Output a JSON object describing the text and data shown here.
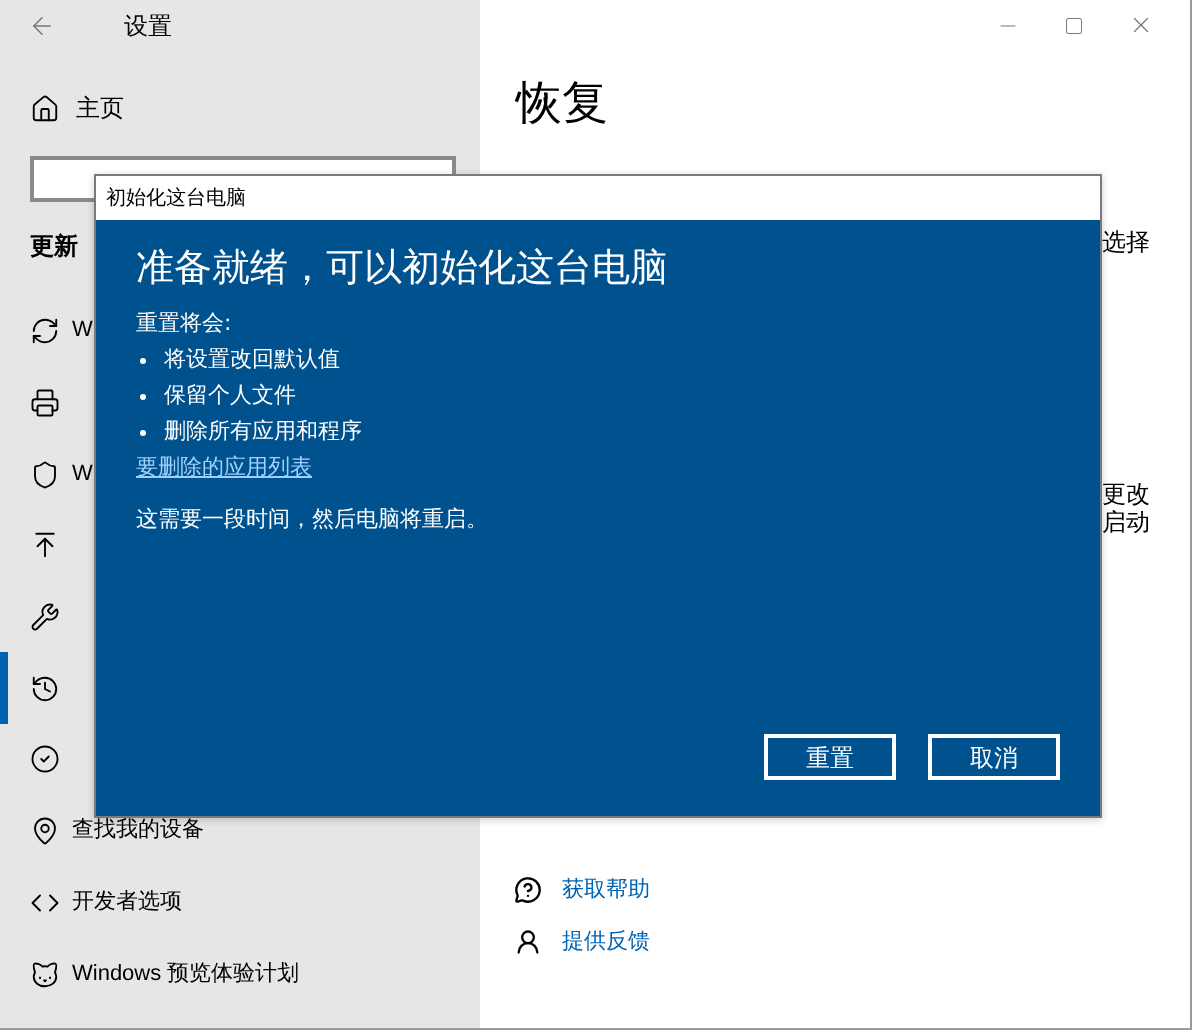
{
  "window": {
    "title": "设置"
  },
  "sidebar": {
    "home": "主页",
    "section": "更新",
    "items": [
      {
        "label": "W",
        "selected": false
      },
      {
        "selected": false
      },
      {
        "label": "W",
        "selected": false
      },
      {
        "selected": false
      },
      {
        "selected": false
      },
      {
        "selected": true
      },
      {
        "selected": false
      },
      {
        "label": "查找我的设备",
        "selected": false
      },
      {
        "label": "开发者选项",
        "selected": false
      },
      {
        "label": "Windows 预览体验计划",
        "selected": false
      }
    ]
  },
  "page": {
    "title": "恢复",
    "fragments": [
      "选择",
      "更改",
      "启动"
    ],
    "links": [
      "获取帮助",
      "提供反馈"
    ]
  },
  "dialog": {
    "title": "初始化这台电脑",
    "heading": "准备就绪，可以初始化这台电脑",
    "intro": "重置将会:",
    "bullets": [
      "将设置改回默认值",
      "保留个人文件",
      "删除所有应用和程序"
    ],
    "link": "要删除的应用列表",
    "note": "这需要一段时间，然后电脑将重启。",
    "buttons": [
      "重置",
      "取消"
    ]
  }
}
